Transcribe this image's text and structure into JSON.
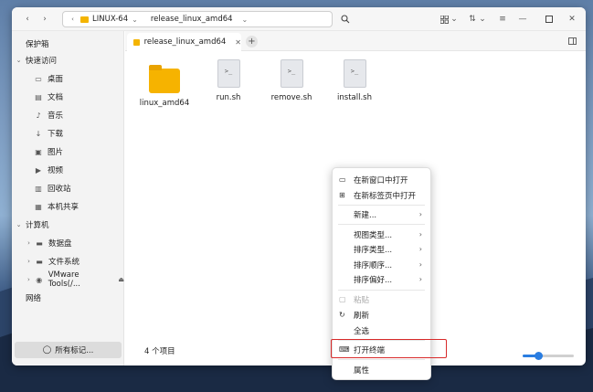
{
  "window": {
    "breadcrumb": [
      "LINUX-64",
      "release_linux_amd64"
    ],
    "tab_label": "release_linux_amd64"
  },
  "sidebar": {
    "vault": "保护箱",
    "quick_access": "快速访问",
    "items": [
      "桌面",
      "文档",
      "音乐",
      "下载",
      "图片",
      "视频",
      "回收站",
      "本机共享"
    ],
    "computer": "计算机",
    "drives": [
      "数据盘",
      "文件系统",
      "VMware Tools(/..."
    ],
    "network": "网络",
    "tags_button": "所有标记..."
  },
  "files": [
    {
      "name": "linux_amd64",
      "type": "folder"
    },
    {
      "name": "run.sh",
      "type": "script"
    },
    {
      "name": "remove.sh",
      "type": "script"
    },
    {
      "name": "install.sh",
      "type": "script"
    }
  ],
  "script_icon_glyph": ">_",
  "status": {
    "count_text": "4 个项目"
  },
  "context_menu": {
    "open_new_window": "在新窗口中打开",
    "open_new_tab": "在新标签页中打开",
    "new": "新建...",
    "view_type": "视图类型...",
    "sort_type": "排序类型...",
    "sort_order": "排序顺序...",
    "sort_pref": "排序偏好...",
    "paste": "粘贴",
    "refresh": "刷新",
    "select_all": "全选",
    "open_terminal": "打开终端",
    "properties": "属性"
  },
  "colors": {
    "accent": "#2a7de1",
    "highlight_box": "#d82a2a",
    "folder": "#f6b300"
  }
}
